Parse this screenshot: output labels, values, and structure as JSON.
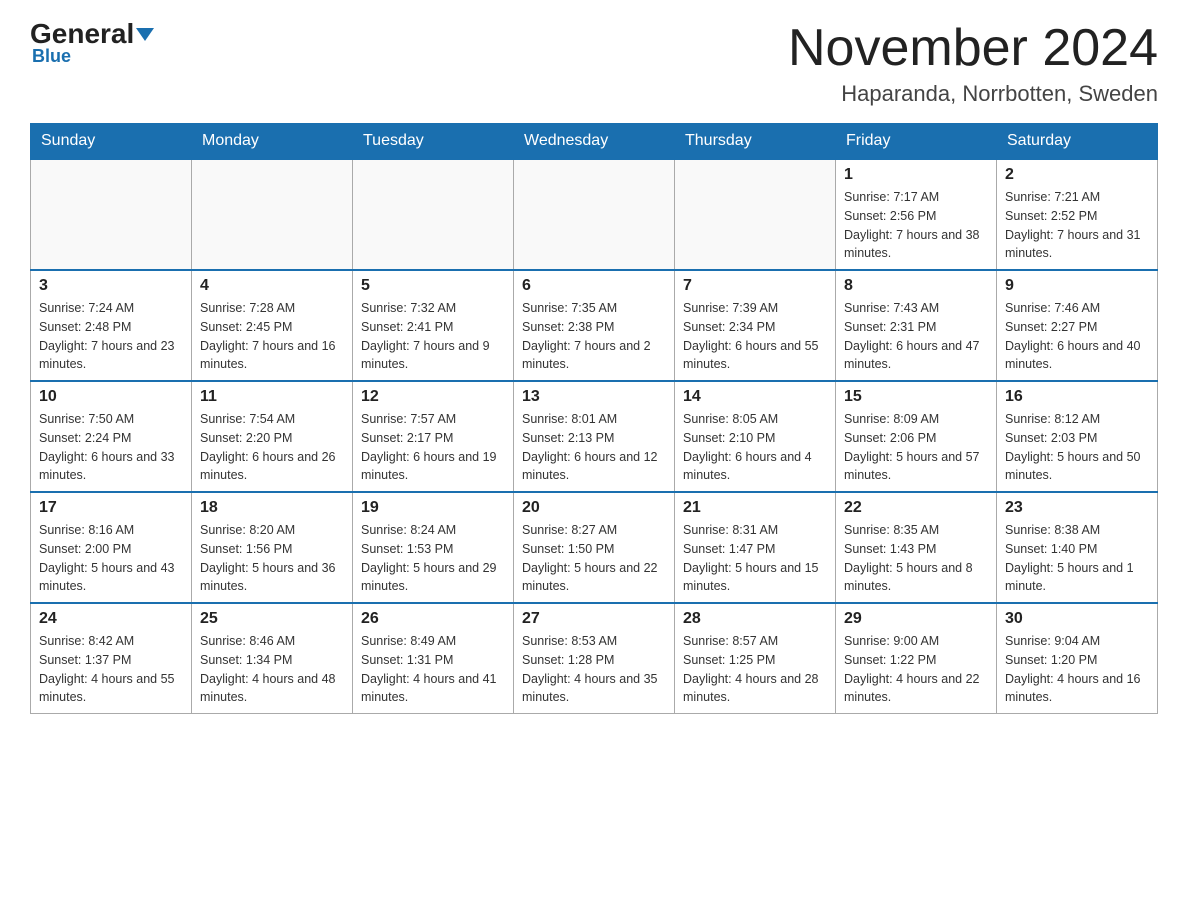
{
  "header": {
    "logo_general": "General",
    "logo_blue": "Blue",
    "month_title": "November 2024",
    "location": "Haparanda, Norrbotten, Sweden"
  },
  "days_of_week": [
    "Sunday",
    "Monday",
    "Tuesday",
    "Wednesday",
    "Thursday",
    "Friday",
    "Saturday"
  ],
  "weeks": [
    {
      "days": [
        {
          "number": "",
          "info": "",
          "empty": true
        },
        {
          "number": "",
          "info": "",
          "empty": true
        },
        {
          "number": "",
          "info": "",
          "empty": true
        },
        {
          "number": "",
          "info": "",
          "empty": true
        },
        {
          "number": "",
          "info": "",
          "empty": true
        },
        {
          "number": "1",
          "info": "Sunrise: 7:17 AM\nSunset: 2:56 PM\nDaylight: 7 hours and 38 minutes."
        },
        {
          "number": "2",
          "info": "Sunrise: 7:21 AM\nSunset: 2:52 PM\nDaylight: 7 hours and 31 minutes."
        }
      ]
    },
    {
      "days": [
        {
          "number": "3",
          "info": "Sunrise: 7:24 AM\nSunset: 2:48 PM\nDaylight: 7 hours and 23 minutes."
        },
        {
          "number": "4",
          "info": "Sunrise: 7:28 AM\nSunset: 2:45 PM\nDaylight: 7 hours and 16 minutes."
        },
        {
          "number": "5",
          "info": "Sunrise: 7:32 AM\nSunset: 2:41 PM\nDaylight: 7 hours and 9 minutes."
        },
        {
          "number": "6",
          "info": "Sunrise: 7:35 AM\nSunset: 2:38 PM\nDaylight: 7 hours and 2 minutes."
        },
        {
          "number": "7",
          "info": "Sunrise: 7:39 AM\nSunset: 2:34 PM\nDaylight: 6 hours and 55 minutes."
        },
        {
          "number": "8",
          "info": "Sunrise: 7:43 AM\nSunset: 2:31 PM\nDaylight: 6 hours and 47 minutes."
        },
        {
          "number": "9",
          "info": "Sunrise: 7:46 AM\nSunset: 2:27 PM\nDaylight: 6 hours and 40 minutes."
        }
      ]
    },
    {
      "days": [
        {
          "number": "10",
          "info": "Sunrise: 7:50 AM\nSunset: 2:24 PM\nDaylight: 6 hours and 33 minutes."
        },
        {
          "number": "11",
          "info": "Sunrise: 7:54 AM\nSunset: 2:20 PM\nDaylight: 6 hours and 26 minutes."
        },
        {
          "number": "12",
          "info": "Sunrise: 7:57 AM\nSunset: 2:17 PM\nDaylight: 6 hours and 19 minutes."
        },
        {
          "number": "13",
          "info": "Sunrise: 8:01 AM\nSunset: 2:13 PM\nDaylight: 6 hours and 12 minutes."
        },
        {
          "number": "14",
          "info": "Sunrise: 8:05 AM\nSunset: 2:10 PM\nDaylight: 6 hours and 4 minutes."
        },
        {
          "number": "15",
          "info": "Sunrise: 8:09 AM\nSunset: 2:06 PM\nDaylight: 5 hours and 57 minutes."
        },
        {
          "number": "16",
          "info": "Sunrise: 8:12 AM\nSunset: 2:03 PM\nDaylight: 5 hours and 50 minutes."
        }
      ]
    },
    {
      "days": [
        {
          "number": "17",
          "info": "Sunrise: 8:16 AM\nSunset: 2:00 PM\nDaylight: 5 hours and 43 minutes."
        },
        {
          "number": "18",
          "info": "Sunrise: 8:20 AM\nSunset: 1:56 PM\nDaylight: 5 hours and 36 minutes."
        },
        {
          "number": "19",
          "info": "Sunrise: 8:24 AM\nSunset: 1:53 PM\nDaylight: 5 hours and 29 minutes."
        },
        {
          "number": "20",
          "info": "Sunrise: 8:27 AM\nSunset: 1:50 PM\nDaylight: 5 hours and 22 minutes."
        },
        {
          "number": "21",
          "info": "Sunrise: 8:31 AM\nSunset: 1:47 PM\nDaylight: 5 hours and 15 minutes."
        },
        {
          "number": "22",
          "info": "Sunrise: 8:35 AM\nSunset: 1:43 PM\nDaylight: 5 hours and 8 minutes."
        },
        {
          "number": "23",
          "info": "Sunrise: 8:38 AM\nSunset: 1:40 PM\nDaylight: 5 hours and 1 minute."
        }
      ]
    },
    {
      "days": [
        {
          "number": "24",
          "info": "Sunrise: 8:42 AM\nSunset: 1:37 PM\nDaylight: 4 hours and 55 minutes."
        },
        {
          "number": "25",
          "info": "Sunrise: 8:46 AM\nSunset: 1:34 PM\nDaylight: 4 hours and 48 minutes."
        },
        {
          "number": "26",
          "info": "Sunrise: 8:49 AM\nSunset: 1:31 PM\nDaylight: 4 hours and 41 minutes."
        },
        {
          "number": "27",
          "info": "Sunrise: 8:53 AM\nSunset: 1:28 PM\nDaylight: 4 hours and 35 minutes."
        },
        {
          "number": "28",
          "info": "Sunrise: 8:57 AM\nSunset: 1:25 PM\nDaylight: 4 hours and 28 minutes."
        },
        {
          "number": "29",
          "info": "Sunrise: 9:00 AM\nSunset: 1:22 PM\nDaylight: 4 hours and 22 minutes."
        },
        {
          "number": "30",
          "info": "Sunrise: 9:04 AM\nSunset: 1:20 PM\nDaylight: 4 hours and 16 minutes."
        }
      ]
    }
  ]
}
